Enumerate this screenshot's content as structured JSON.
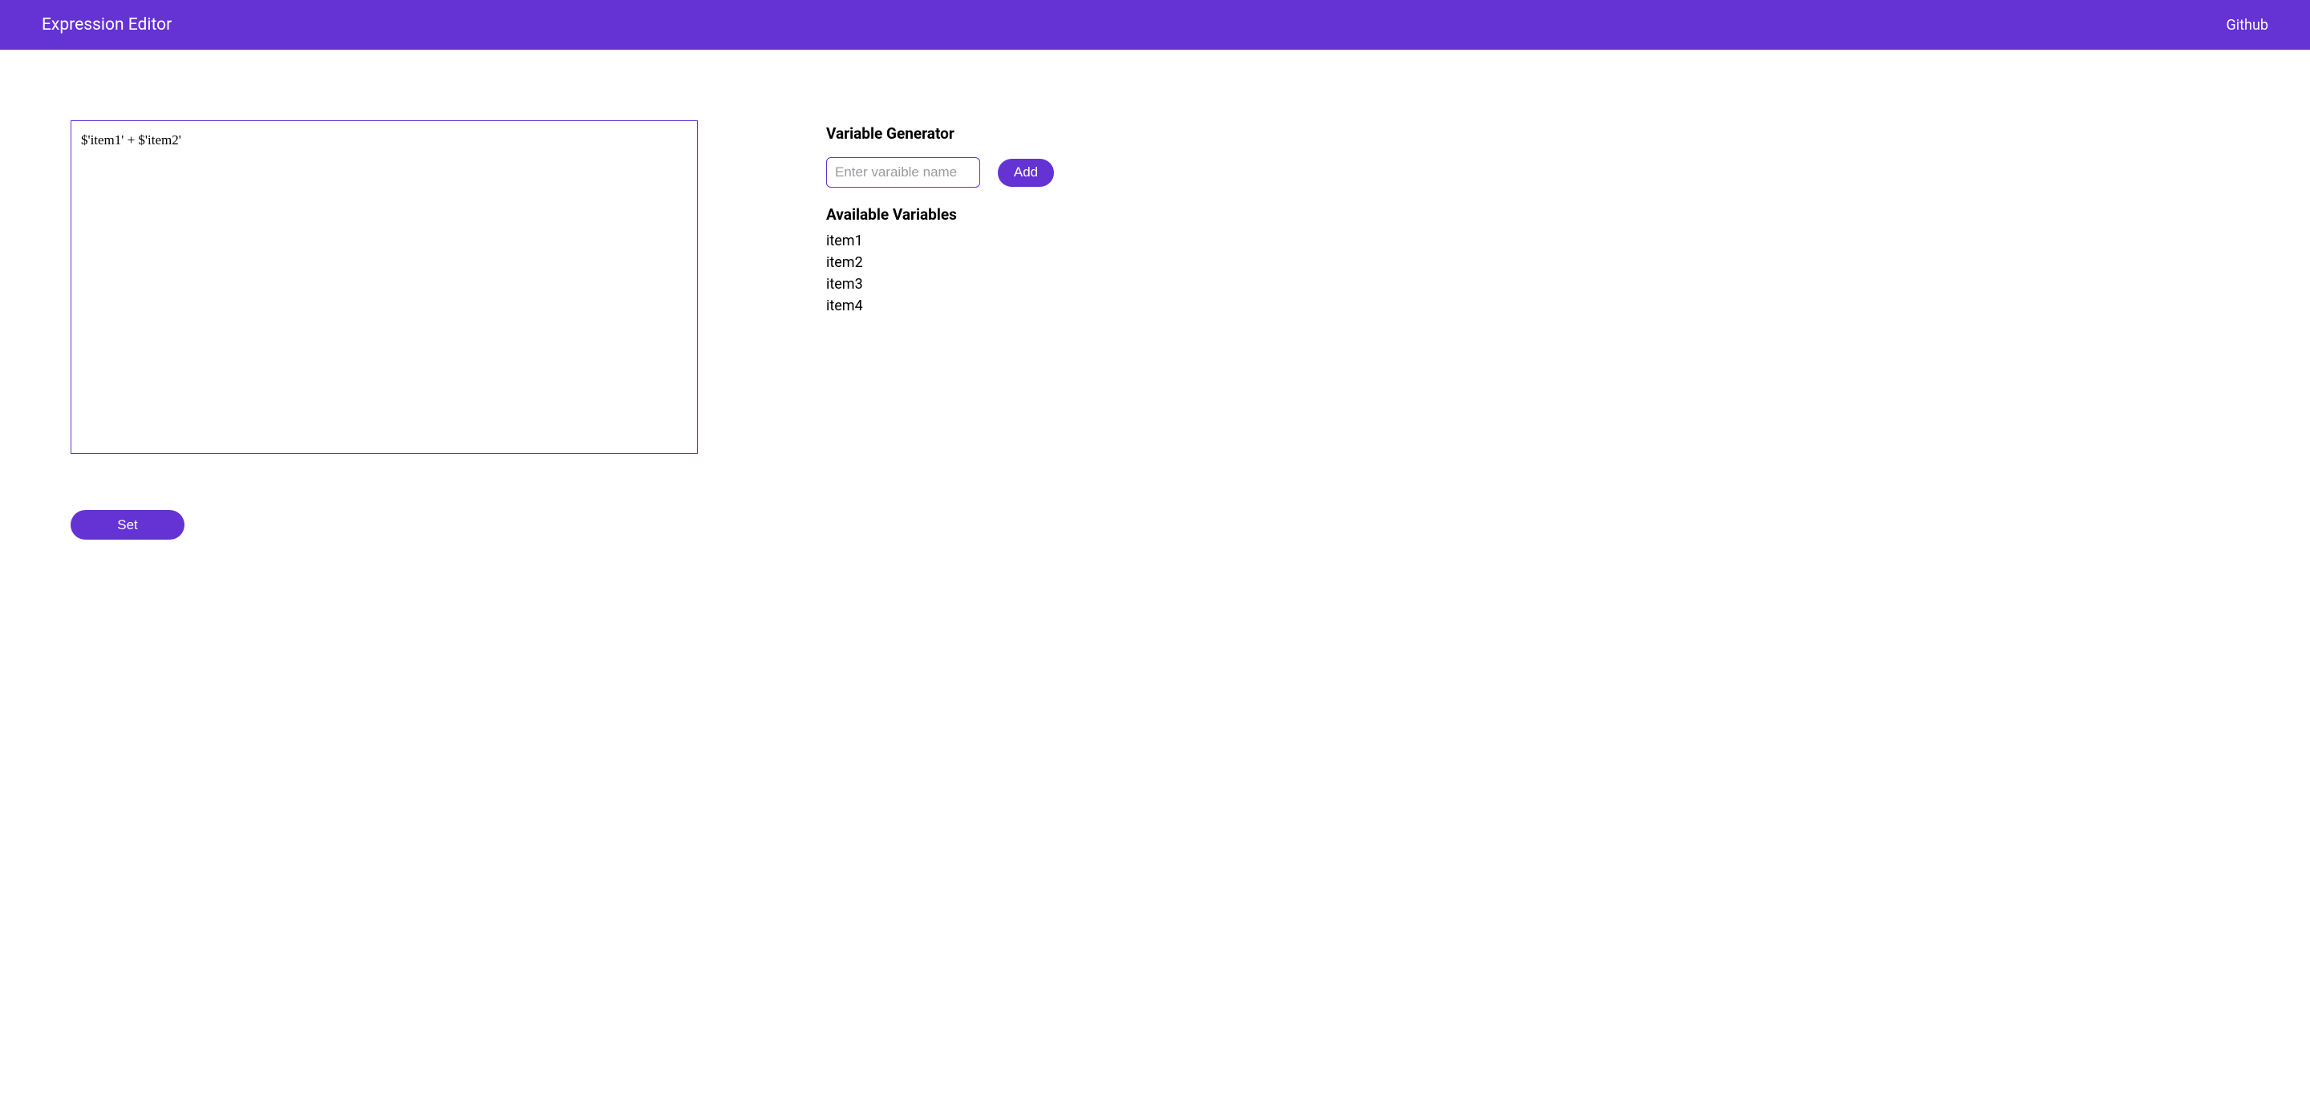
{
  "navbar": {
    "title": "Expression Editor",
    "github_link": "Github"
  },
  "editor": {
    "content": "$'item1' + $'item2'"
  },
  "buttons": {
    "set_label": "Set",
    "add_label": "Add"
  },
  "sidebar": {
    "generator_heading": "Variable Generator",
    "input_placeholder": "Enter varaible name",
    "available_heading": "Available Variables",
    "variables": [
      {
        "name": "item1"
      },
      {
        "name": "item2"
      },
      {
        "name": "item3"
      },
      {
        "name": "item4"
      }
    ]
  }
}
